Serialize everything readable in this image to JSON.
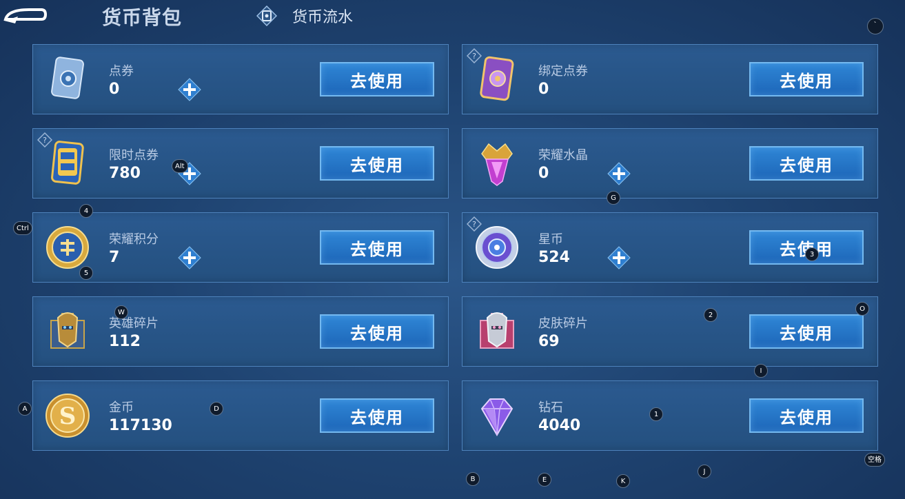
{
  "header": {
    "title": "货币背包",
    "flow_label": "货币流水",
    "corner_marker": "`"
  },
  "cards": [
    {
      "label": "点券",
      "value": "0",
      "button": "去使用",
      "icon": "ticket-icon",
      "has_plus": true,
      "has_help": false
    },
    {
      "label": "绑定点券",
      "value": "0",
      "button": "去使用",
      "icon": "bound-ticket-icon",
      "has_plus": false,
      "has_help": true
    },
    {
      "label": "限时点券",
      "value": "780",
      "button": "去使用",
      "icon": "limited-ticket-icon",
      "has_plus": true,
      "has_help": true
    },
    {
      "label": "荣耀水晶",
      "value": "0",
      "button": "去使用",
      "icon": "glory-crystal-icon",
      "has_plus": true,
      "has_help": false
    },
    {
      "label": "荣耀积分",
      "value": "7",
      "button": "去使用",
      "icon": "glory-points-icon",
      "has_plus": true,
      "has_help": false
    },
    {
      "label": "星币",
      "value": "524",
      "button": "去使用",
      "icon": "star-coin-icon",
      "has_plus": true,
      "has_help": true
    },
    {
      "label": "英雄碎片",
      "value": "112",
      "button": "去使用",
      "icon": "hero-fragment-icon",
      "has_plus": false,
      "has_help": false
    },
    {
      "label": "皮肤碎片",
      "value": "69",
      "button": "去使用",
      "icon": "skin-fragment-icon",
      "has_plus": false,
      "has_help": false
    },
    {
      "label": "金币",
      "value": "117130",
      "button": "去使用",
      "icon": "gold-coin-icon",
      "has_plus": false,
      "has_help": false
    },
    {
      "label": "钻石",
      "value": "4040",
      "button": "去使用",
      "icon": "diamond-icon",
      "has_plus": false,
      "has_help": false
    }
  ],
  "markers": {
    "alt": "Alt",
    "ctrl": "Ctrl",
    "m4": "4",
    "m5": "5",
    "w": "W",
    "g": "G",
    "m3": "3",
    "m2": "2",
    "o": "O",
    "i": "I",
    "a": "A",
    "d": "D",
    "m1": "1",
    "space": "空格",
    "b": "B",
    "e": "E",
    "k": "K",
    "j": "J"
  },
  "colors": {
    "background": "#1f4472",
    "card": "#2b5a90",
    "card_border": "#4e83bd",
    "button": "#2f86d6",
    "button_border": "#74b9f0",
    "plus": "#2f7fd0"
  }
}
